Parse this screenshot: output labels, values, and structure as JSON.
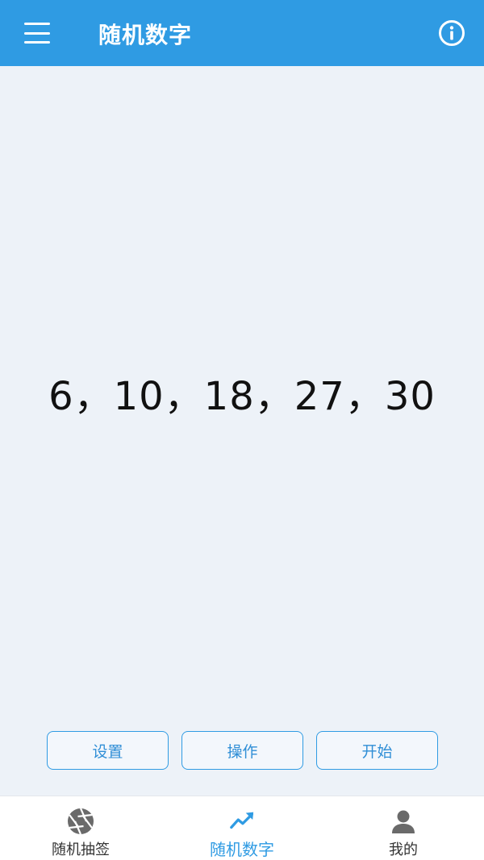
{
  "header": {
    "title": "随机数字",
    "menu_icon": "menu-icon",
    "info_icon": "info-icon"
  },
  "main": {
    "result": "6，10，18，27，30"
  },
  "actions": {
    "settings_label": "设置",
    "operate_label": "操作",
    "start_label": "开始"
  },
  "bottom_nav": {
    "items": [
      {
        "label": "随机抽签",
        "icon": "aperture-icon",
        "active": false
      },
      {
        "label": "随机数字",
        "icon": "trending-up-icon",
        "active": true
      },
      {
        "label": "我的",
        "icon": "person-icon",
        "active": false
      }
    ]
  },
  "colors": {
    "primary": "#2f9be3",
    "background": "#edf2f8",
    "inactive_icon": "#6a6a6a"
  }
}
